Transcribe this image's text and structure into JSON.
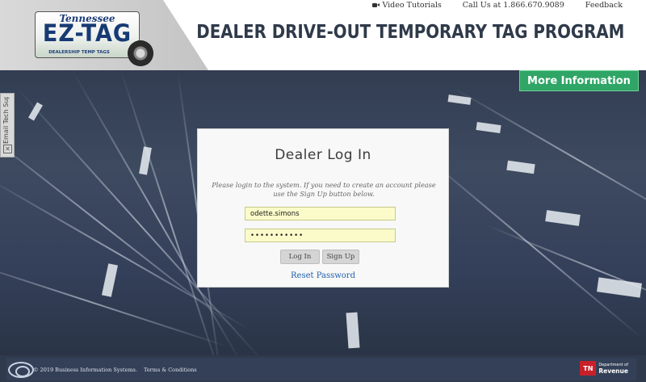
{
  "header": {
    "plate": {
      "state": "Tennessee",
      "main": "EZ-TAG",
      "sub": "DEALERSHIP TEMP TAGS"
    },
    "links": [
      {
        "label": "Video Tutorials",
        "icon": "video-icon"
      },
      {
        "label": "Call Us at 1.866.670.9089"
      },
      {
        "label": "Feedback"
      }
    ],
    "program_title": "DEALER DRIVE-OUT TEMPORARY TAG PROGRAM",
    "more_info": "More Information"
  },
  "side_tab": {
    "label": "Email Tech Support",
    "icon": "close-icon"
  },
  "login": {
    "title": "Dealer Log In",
    "message": "Please login to the system. If you need to create an account please use the Sign Up button below.",
    "username_value": "odette.simons",
    "password_value": "•••••••••••",
    "login_button": "Log In",
    "signup_button": "Sign Up",
    "reset_link": "Reset Password"
  },
  "footer": {
    "copyright": "© 2019  Business Information Systems.",
    "terms": "Terms & Conditions",
    "tn_badge": "TN",
    "tn_dept_line1": "Department of",
    "tn_dept_line2": "Revenue"
  },
  "colors": {
    "accent_green": "#2fa566",
    "link_blue": "#1f5fb0",
    "field_yellow": "#fafbc9"
  }
}
